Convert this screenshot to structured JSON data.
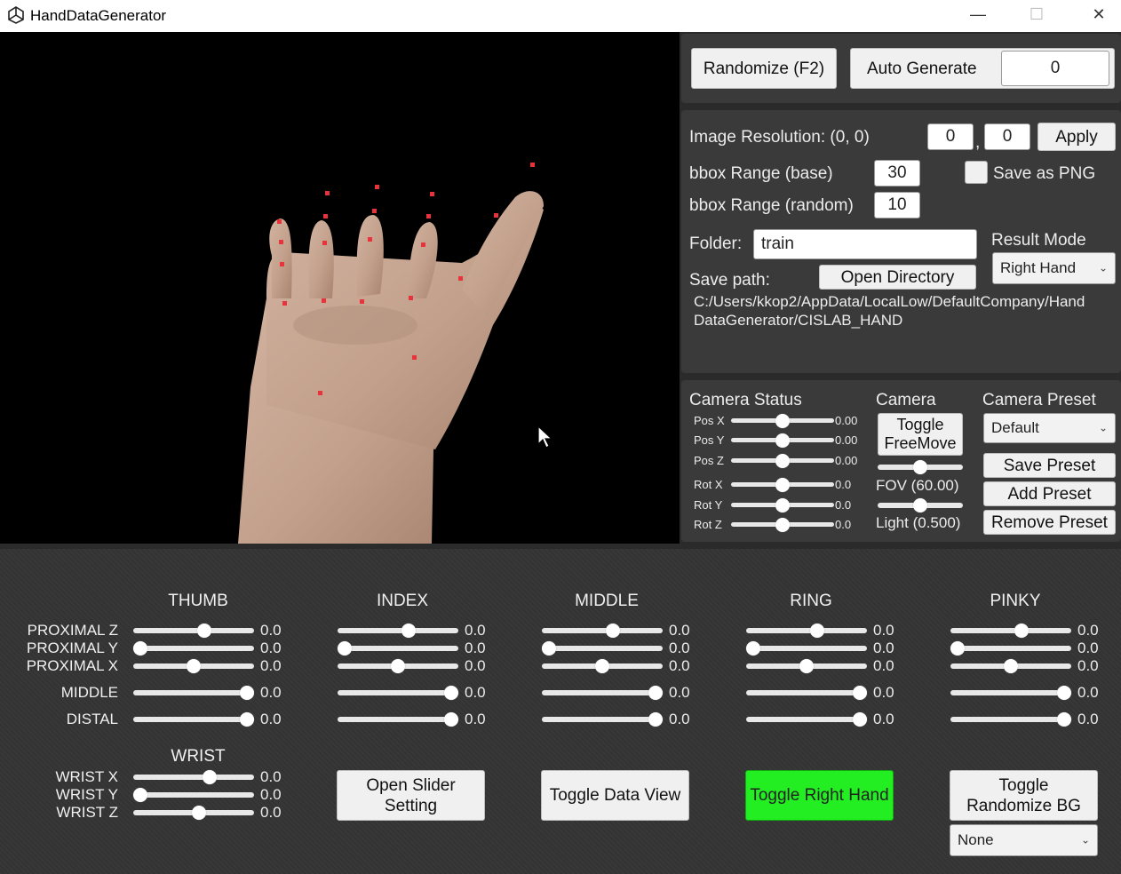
{
  "window": {
    "title": "HandDataGenerator",
    "minimize": "—",
    "maximize": "☐",
    "close": "✕",
    "app_icon": "unity-logo-icon"
  },
  "top": {
    "randomize_label": "Randomize (F2)",
    "auto_generate_label": "Auto Generate",
    "auto_generate_value": "0"
  },
  "settings": {
    "resolution_label": "Image Resolution: (0, 0)",
    "res_w": "0",
    "res_h": "0",
    "comma": ",",
    "apply_label": "Apply",
    "bbox_base_label": "bbox Range (base)",
    "bbox_base_value": "30",
    "save_png_label": "Save as PNG",
    "bbox_random_label": "bbox Range (random)",
    "bbox_random_value": "10",
    "folder_label": "Folder:",
    "folder_value": "train",
    "result_mode_label": "Result Mode",
    "result_mode_value": "Right Hand",
    "save_path_label": "Save path:",
    "open_directory_label": "Open Directory",
    "path_line1": "C:/Users/kkop2/AppData/LocalLow/DefaultCompany/Hand",
    "path_line2": "DataGenerator/CISLAB_HAND"
  },
  "camera_status": {
    "title": "Camera Status",
    "rows": [
      {
        "label": "Pos X",
        "value": "0.00",
        "level": 0.5
      },
      {
        "label": "Pos Y",
        "value": "0.00",
        "level": 0.5
      },
      {
        "label": "Pos Z",
        "value": "0.00",
        "level": 0.5
      },
      {
        "label": "Rot X",
        "value": "0.0",
        "level": 0.5
      },
      {
        "label": "Rot Y",
        "value": "0.0",
        "level": 0.5
      },
      {
        "label": "Rot Z",
        "value": "0.0",
        "level": 0.5
      }
    ]
  },
  "camera": {
    "title": "Camera",
    "toggle_label_1": "Toggle",
    "toggle_label_2": "FreeMove",
    "fov_label": "FOV (60.00)",
    "fov_level": 0.5,
    "light_label": "Light (0.500)",
    "light_level": 0.5
  },
  "camera_preset": {
    "title": "Camera Preset",
    "selected": "Default",
    "save_label": "Save Preset",
    "add_label": "Add Preset",
    "remove_label": "Remove Preset"
  },
  "fingers": {
    "columns": [
      "THUMB",
      "INDEX",
      "MIDDLE",
      "RING",
      "PINKY"
    ],
    "row_labels": [
      "PROXIMAL Z",
      "PROXIMAL Y",
      "PROXIMAL X",
      "MIDDLE",
      "DISTAL"
    ],
    "value": "0.0",
    "levels": [
      0.6,
      0.0,
      0.5,
      1.0,
      1.0
    ]
  },
  "wrist": {
    "title": "WRIST",
    "rows": [
      {
        "label": "WRIST X",
        "value": "0.0",
        "level": 0.65
      },
      {
        "label": "WRIST Y",
        "value": "0.0",
        "level": 0.0
      },
      {
        "label": "WRIST Z",
        "value": "0.0",
        "level": 0.55
      }
    ]
  },
  "actions": {
    "open_slider_1": "Open Slider",
    "open_slider_2": "Setting",
    "toggle_data_view": "Toggle Data View",
    "toggle_right_hand": "Toggle Right Hand",
    "toggle_right_hand_color": "#22ee22",
    "toggle_bg_1": "Toggle",
    "toggle_bg_2": "Randomize BG",
    "bg_select": "None"
  }
}
